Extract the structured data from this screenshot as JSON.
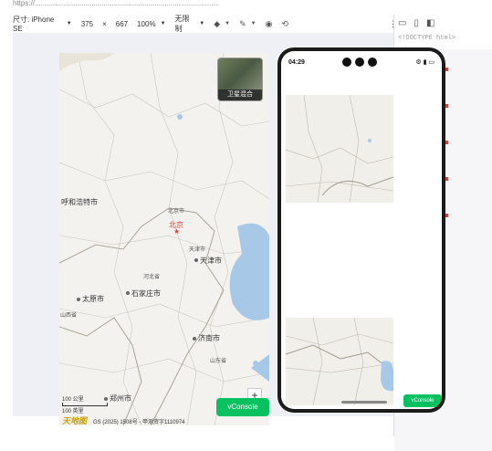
{
  "browser": {
    "url_text": "https://...........................................................................................",
    "toolbar": {
      "dimensions_label": "尺寸: iPhone SE",
      "width": "375",
      "times": "×",
      "height": "667",
      "zoom": "100%",
      "throttle": "无限制",
      "more": "⋮"
    }
  },
  "devtools": {
    "code_snippet": "<!DOCTYPE html>"
  },
  "map": {
    "satellite_label": "卫星混合",
    "cities": {
      "hohhot": "呼和浩特市",
      "beijing_district": "北京市",
      "beijing": "北京",
      "tianjin_district": "天津市",
      "tianjin": "天津市",
      "hebei": "河北省",
      "taiyuan": "太原市",
      "shijiazhuang": "石家庄市",
      "shanxi": "山西省",
      "jinan": "济南市",
      "shandong": "山东省",
      "zhengzhou": "郑州市"
    },
    "scale_km": "100 公里",
    "scale_mi": "100 英里",
    "copyright": "GS (2025) 1508号 - 甲测资字1110974",
    "logo": "天地图",
    "zoom_in": "+",
    "vconsole": "vConsole"
  },
  "phone": {
    "time": "04:29",
    "status_right": "⚙ ▮ ▭",
    "vconsole": "vConsole"
  },
  "colors": {
    "vconsole_green": "#07c160",
    "sea_blue": "#a8c8e8",
    "map_bg": "#f3f2ee"
  }
}
